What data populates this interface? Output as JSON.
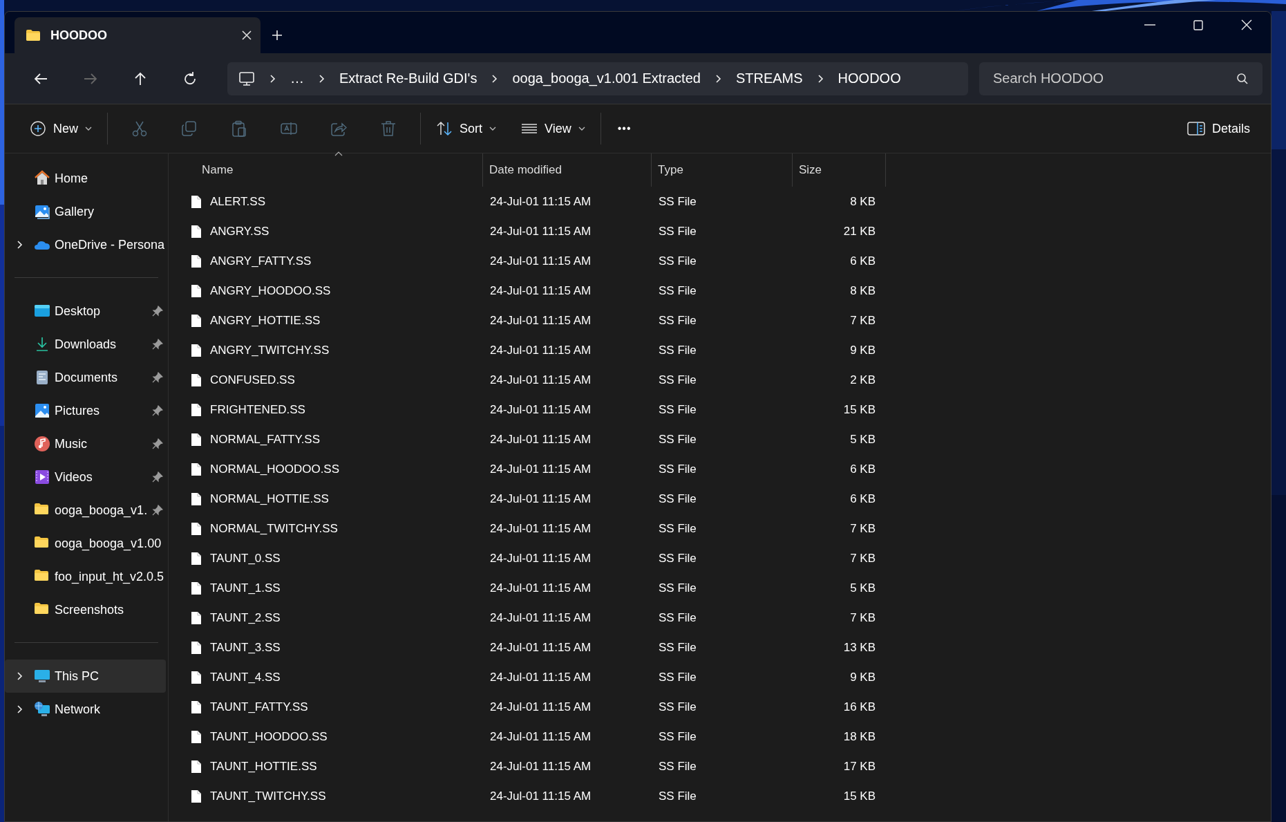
{
  "window": {
    "tab": {
      "title": "HOODOO",
      "selected": true
    }
  },
  "nav": {
    "buttons": [
      {
        "kind": "back",
        "disabled": false
      },
      {
        "kind": "forward",
        "disabled": true
      },
      {
        "kind": "up",
        "disabled": false
      },
      {
        "kind": "refresh",
        "disabled": false
      }
    ],
    "breadcrumb": [
      "…",
      "Extract Re-Build GDI's",
      "ooga_booga_v1.001 Extracted",
      "STREAMS",
      "HOODOO"
    ],
    "search": {
      "placeholder": "Search HOODOO"
    }
  },
  "toolbar": {
    "new_label": "New",
    "actions": [
      {
        "kind": "cut",
        "disabled": true
      },
      {
        "kind": "copy",
        "disabled": true
      },
      {
        "kind": "paste",
        "disabled": true
      },
      {
        "kind": "rename",
        "disabled": true
      },
      {
        "kind": "share",
        "disabled": true
      },
      {
        "kind": "delete",
        "disabled": true
      }
    ],
    "sort_label": "Sort",
    "view_label": "View",
    "more": "•••",
    "details_label": "Details"
  },
  "sidebar": {
    "groups": [
      [
        {
          "label": "Home",
          "kind": "home",
          "expandable": false,
          "pinned": false,
          "selected": false
        },
        {
          "label": "Gallery",
          "kind": "gallery",
          "expandable": false,
          "pinned": false,
          "selected": false
        },
        {
          "label": "OneDrive - Persona",
          "kind": "cloud",
          "expandable": true,
          "pinned": false,
          "selected": false
        }
      ],
      [
        {
          "label": "Desktop",
          "kind": "desktop",
          "expandable": false,
          "pinned": true,
          "selected": false
        },
        {
          "label": "Downloads",
          "kind": "download",
          "expandable": false,
          "pinned": true,
          "selected": false
        },
        {
          "label": "Documents",
          "kind": "document",
          "expandable": false,
          "pinned": true,
          "selected": false
        },
        {
          "label": "Pictures",
          "kind": "pictures",
          "expandable": false,
          "pinned": true,
          "selected": false
        },
        {
          "label": "Music",
          "kind": "music",
          "expandable": false,
          "pinned": true,
          "selected": false
        },
        {
          "label": "Videos",
          "kind": "videos",
          "expandable": false,
          "pinned": true,
          "selected": false
        },
        {
          "label": "ooga_booga_v1.",
          "kind": "folder",
          "expandable": false,
          "pinned": true,
          "selected": false
        },
        {
          "label": "ooga_booga_v1.00",
          "kind": "folder",
          "expandable": false,
          "pinned": false,
          "selected": false
        },
        {
          "label": "foo_input_ht_v2.0.5",
          "kind": "folder",
          "expandable": false,
          "pinned": false,
          "selected": false
        },
        {
          "label": "Screenshots",
          "kind": "folder",
          "expandable": false,
          "pinned": false,
          "selected": false
        }
      ],
      [
        {
          "label": "This PC",
          "kind": "pc",
          "expandable": true,
          "pinned": false,
          "selected": true
        },
        {
          "label": "Network",
          "kind": "network",
          "expandable": true,
          "pinned": false,
          "selected": false
        }
      ]
    ]
  },
  "table": {
    "columns": [
      {
        "label": "Name",
        "sorted": true
      },
      {
        "label": "Date modified",
        "sorted": false
      },
      {
        "label": "Type",
        "sorted": false
      },
      {
        "label": "Size",
        "sorted": false
      }
    ],
    "rows": [
      {
        "name": "ALERT.SS",
        "date": "24-Jul-01 11:15 AM",
        "type": "SS File",
        "size": "8 KB"
      },
      {
        "name": "ANGRY.SS",
        "date": "24-Jul-01 11:15 AM",
        "type": "SS File",
        "size": "21 KB"
      },
      {
        "name": "ANGRY_FATTY.SS",
        "date": "24-Jul-01 11:15 AM",
        "type": "SS File",
        "size": "6 KB"
      },
      {
        "name": "ANGRY_HOODOO.SS",
        "date": "24-Jul-01 11:15 AM",
        "type": "SS File",
        "size": "8 KB"
      },
      {
        "name": "ANGRY_HOTTIE.SS",
        "date": "24-Jul-01 11:15 AM",
        "type": "SS File",
        "size": "7 KB"
      },
      {
        "name": "ANGRY_TWITCHY.SS",
        "date": "24-Jul-01 11:15 AM",
        "type": "SS File",
        "size": "9 KB"
      },
      {
        "name": "CONFUSED.SS",
        "date": "24-Jul-01 11:15 AM",
        "type": "SS File",
        "size": "2 KB"
      },
      {
        "name": "FRIGHTENED.SS",
        "date": "24-Jul-01 11:15 AM",
        "type": "SS File",
        "size": "15 KB"
      },
      {
        "name": "NORMAL_FATTY.SS",
        "date": "24-Jul-01 11:15 AM",
        "type": "SS File",
        "size": "5 KB"
      },
      {
        "name": "NORMAL_HOODOO.SS",
        "date": "24-Jul-01 11:15 AM",
        "type": "SS File",
        "size": "6 KB"
      },
      {
        "name": "NORMAL_HOTTIE.SS",
        "date": "24-Jul-01 11:15 AM",
        "type": "SS File",
        "size": "6 KB"
      },
      {
        "name": "NORMAL_TWITCHY.SS",
        "date": "24-Jul-01 11:15 AM",
        "type": "SS File",
        "size": "7 KB"
      },
      {
        "name": "TAUNT_0.SS",
        "date": "24-Jul-01 11:15 AM",
        "type": "SS File",
        "size": "7 KB"
      },
      {
        "name": "TAUNT_1.SS",
        "date": "24-Jul-01 11:15 AM",
        "type": "SS File",
        "size": "5 KB"
      },
      {
        "name": "TAUNT_2.SS",
        "date": "24-Jul-01 11:15 AM",
        "type": "SS File",
        "size": "7 KB"
      },
      {
        "name": "TAUNT_3.SS",
        "date": "24-Jul-01 11:15 AM",
        "type": "SS File",
        "size": "13 KB"
      },
      {
        "name": "TAUNT_4.SS",
        "date": "24-Jul-01 11:15 AM",
        "type": "SS File",
        "size": "9 KB"
      },
      {
        "name": "TAUNT_FATTY.SS",
        "date": "24-Jul-01 11:15 AM",
        "type": "SS File",
        "size": "16 KB"
      },
      {
        "name": "TAUNT_HOODOO.SS",
        "date": "24-Jul-01 11:15 AM",
        "type": "SS File",
        "size": "18 KB"
      },
      {
        "name": "TAUNT_HOTTIE.SS",
        "date": "24-Jul-01 11:15 AM",
        "type": "SS File",
        "size": "17 KB"
      },
      {
        "name": "TAUNT_TWITCHY.SS",
        "date": "24-Jul-01 11:15 AM",
        "type": "SS File",
        "size": "15 KB"
      }
    ]
  }
}
